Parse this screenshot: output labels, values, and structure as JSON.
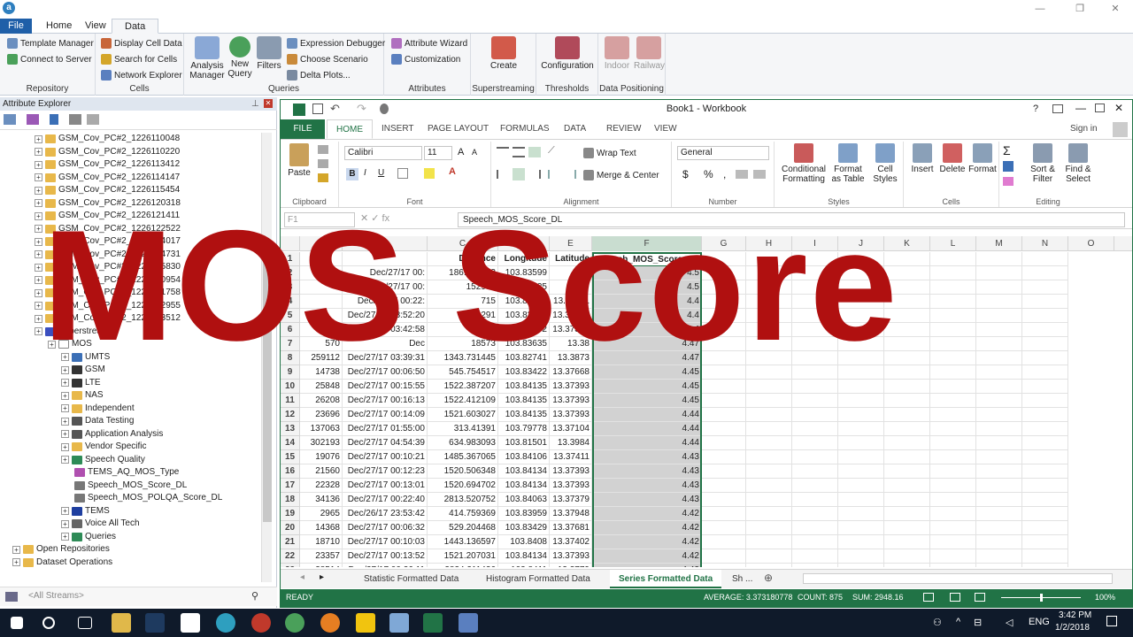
{
  "app": {
    "logo": "a",
    "tabs": [
      "File",
      "Home",
      "View",
      "Data"
    ],
    "ribbon_groups": [
      {
        "label": "Repository",
        "items": [
          "Template Manager",
          "Connect to Server"
        ]
      },
      {
        "label": "Cells",
        "items": [
          "Display Cell Data",
          "Search for Cells",
          "Network Explorer"
        ]
      },
      {
        "label": "Queries",
        "items": [
          "Analysis Manager",
          "New Query",
          "Filters",
          "Expression Debugger",
          "Choose Scenario",
          "Delta Plots..."
        ]
      },
      {
        "label": "Attributes",
        "items": [
          "Attribute Wizard",
          "Customization"
        ]
      },
      {
        "label": "Superstreaming",
        "items": [
          "Create"
        ]
      },
      {
        "label": "Thresholds",
        "items": [
          "Configuration"
        ]
      },
      {
        "label": "Data Positioning",
        "items": [
          "Indoor",
          "Railway"
        ]
      }
    ]
  },
  "explorer": {
    "title": "Attribute Explorer",
    "tree": [
      {
        "label": "GSM_Cov_PC#2_1226110048",
        "depth": 1,
        "kind": "folder"
      },
      {
        "label": "GSM_Cov_PC#2_1226110220",
        "depth": 1,
        "kind": "folder"
      },
      {
        "label": "GSM_Cov_PC#2_1226113412",
        "depth": 1,
        "kind": "folder"
      },
      {
        "label": "GSM_Cov_PC#2_1226114147",
        "depth": 1,
        "kind": "folder"
      },
      {
        "label": "GSM_Cov_PC#2_1226115454",
        "depth": 1,
        "kind": "folder"
      },
      {
        "label": "GSM_Cov_PC#2_1226120318",
        "depth": 1,
        "kind": "folder"
      },
      {
        "label": "GSM_Cov_PC#2_1226121411",
        "depth": 1,
        "kind": "folder"
      },
      {
        "label": "GSM_Cov_PC#2_1226122522",
        "depth": 1,
        "kind": "folder"
      },
      {
        "label": "GSM_Cov_PC#2_1226124017",
        "depth": 1,
        "kind": "folder"
      },
      {
        "label": "GSM_Cov_PC#2_1226124731",
        "depth": 1,
        "kind": "folder"
      },
      {
        "label": "GSM_Cov_PC#2_1226125830",
        "depth": 1,
        "kind": "folder"
      },
      {
        "label": "GSM_Cov_PC#2_1226130954",
        "depth": 1,
        "kind": "folder"
      },
      {
        "label": "GSM_Cov_PC#2_1226131758",
        "depth": 1,
        "kind": "folder"
      },
      {
        "label": "GSM_Cov_PC#2_1226132955",
        "depth": 1,
        "kind": "folder"
      },
      {
        "label": "GSM_Cov_PC#2_1226133512",
        "depth": 1,
        "kind": "folder"
      },
      {
        "label": "Superstreams",
        "depth": 1,
        "kind": "funnel"
      },
      {
        "label": "MOS",
        "depth": 2,
        "kind": "doc"
      },
      {
        "label": "UMTS",
        "depth": 3,
        "kind": "3g"
      },
      {
        "label": "GSM",
        "depth": 3,
        "kind": "gsm"
      },
      {
        "label": "LTE",
        "depth": 3,
        "kind": "lte"
      },
      {
        "label": "NAS",
        "depth": 3,
        "kind": "folder"
      },
      {
        "label": "Independent",
        "depth": 3,
        "kind": "folder"
      },
      {
        "label": "Data Testing",
        "depth": 3,
        "kind": "grid"
      },
      {
        "label": "Application Analysis",
        "depth": 3,
        "kind": "grid"
      },
      {
        "label": "Vendor Specific",
        "depth": 3,
        "kind": "folder"
      },
      {
        "label": "Speech Quality",
        "depth": 3,
        "kind": "q"
      },
      {
        "label": "TEMS_AQ_MOS_Type",
        "depth": 4,
        "kind": "item"
      },
      {
        "label": "Speech_MOS_Score_DL",
        "depth": 4,
        "kind": "mos"
      },
      {
        "label": "Speech_MOS_POLQA_Score_DL",
        "depth": 4,
        "kind": "mos"
      },
      {
        "label": "TEMS",
        "depth": 3,
        "kind": "tems"
      },
      {
        "label": "Voice All Tech",
        "depth": 3,
        "kind": "gear"
      },
      {
        "label": "Queries",
        "depth": 3,
        "kind": "q"
      },
      {
        "label": "Open Repositories",
        "depth": 0,
        "kind": "folder"
      },
      {
        "label": "Dataset Operations",
        "depth": 0,
        "kind": "folder"
      }
    ],
    "stream_placeholder": "<All Streams>"
  },
  "excel": {
    "title": "Book1 - Workbook",
    "sign_in": "Sign in",
    "tabs": [
      "FILE",
      "HOME",
      "INSERT",
      "PAGE LAYOUT",
      "FORMULAS",
      "DATA",
      "REVIEW",
      "VIEW"
    ],
    "font": "Calibri",
    "font_size": "11",
    "number_format": "General",
    "groups": [
      "Clipboard",
      "Font",
      "Alignment",
      "Number",
      "Styles",
      "Cells",
      "Editing"
    ],
    "buttons": {
      "paste": "Paste",
      "wrap": "Wrap Text",
      "merge": "Merge & Center",
      "cond": "Conditional Formatting",
      "fmt_table": "Format as Table",
      "cell_styles": "Cell Styles",
      "insert": "Insert",
      "delete": "Delete",
      "format": "Format",
      "sort": "Sort & Filter",
      "find": "Find & Select"
    },
    "name_box": "F1",
    "formula": "Speech_MOS_Score_DL",
    "columns": [
      "A",
      "B",
      "C",
      "D",
      "E",
      "F",
      "G",
      "H",
      "I",
      "J",
      "K",
      "L",
      "M",
      "N",
      "O"
    ],
    "headers": [
      "",
      "",
      "Distance",
      "Longitude",
      "Latitude",
      "Speech_MOS_Score_DL"
    ],
    "rows": [
      [
        "",
        "Dec/27/17 00:",
        "186.032623",
        "103.83599",
        "13.3",
        "4.5"
      ],
      [
        "",
        "Dec/27/17 00:",
        "152998",
        "103.84135",
        "13.37",
        "4.5"
      ],
      [
        "",
        "Dec/27/17 00:22:",
        "715",
        "103.84023",
        "13.37311",
        "4.4"
      ],
      [
        "",
        "Dec/27/17 03:52:20",
        "291",
        "103.83229",
        "13.38993",
        "4.4"
      ],
      [
        "",
        "Dec/27/17 03:42:58",
        "403",
        "103.83592",
        "13.37301",
        "4.4"
      ],
      [
        "570",
        "Dec",
        "18573",
        "103.83635",
        "13.38",
        "4.47"
      ],
      [
        "259112",
        "Dec/27/17 03:39:31",
        "1343.731445",
        "103.82741",
        "13.3873",
        "4.47"
      ],
      [
        "14738",
        "Dec/27/17 00:06:50",
        "545.754517",
        "103.83422",
        "13.37668",
        "4.45"
      ],
      [
        "25848",
        "Dec/27/17 00:15:55",
        "1522.387207",
        "103.84135",
        "13.37393",
        "4.45"
      ],
      [
        "26208",
        "Dec/27/17 00:16:13",
        "1522.412109",
        "103.84135",
        "13.37393",
        "4.45"
      ],
      [
        "23696",
        "Dec/27/17 00:14:09",
        "1521.603027",
        "103.84135",
        "13.37393",
        "4.44"
      ],
      [
        "137063",
        "Dec/27/17 01:55:00",
        "313.41391",
        "103.79778",
        "13.37104",
        "4.44"
      ],
      [
        "302193",
        "Dec/27/17 04:54:39",
        "634.983093",
        "103.81501",
        "13.3984",
        "4.44"
      ],
      [
        "19076",
        "Dec/27/17 00:10:21",
        "1485.367065",
        "103.84106",
        "13.37411",
        "4.43"
      ],
      [
        "21560",
        "Dec/27/17 00:12:23",
        "1520.506348",
        "103.84134",
        "13.37393",
        "4.43"
      ],
      [
        "22328",
        "Dec/27/17 00:13:01",
        "1520.694702",
        "103.84134",
        "13.37393",
        "4.43"
      ],
      [
        "34136",
        "Dec/27/17 00:22:40",
        "2813.520752",
        "103.84063",
        "13.37379",
        "4.43"
      ],
      [
        "2965",
        "Dec/26/17 23:53:42",
        "414.759369",
        "103.83959",
        "13.37948",
        "4.42"
      ],
      [
        "14368",
        "Dec/27/17 00:06:32",
        "529.204468",
        "103.83429",
        "13.37681",
        "4.42"
      ],
      [
        "18710",
        "Dec/27/17 00:10:03",
        "1443.136597",
        "103.8408",
        "13.37402",
        "4.42"
      ],
      [
        "23357",
        "Dec/27/17 00:13:52",
        "1521.207031",
        "103.84134",
        "13.37393",
        "4.42"
      ],
      [
        "38514",
        "Dec/27/17 00:26:11",
        "3834.211426",
        "103.8411",
        "13.3779",
        "4.42"
      ]
    ],
    "sheets": [
      "Statistic Formatted Data",
      "Histogram Formatted Data",
      "Series Formatted Data",
      "Sh ..."
    ],
    "status": {
      "ready": "READY",
      "average": "AVERAGE: 3.373180778",
      "count": "COUNT: 875",
      "sum": "SUM: 2948.16",
      "zoom": "100%"
    }
  },
  "taskbar": {
    "lang": "ENG",
    "time": "3:42 PM",
    "date": "1/2/2018"
  },
  "overlay": {
    "text": "MOS Score"
  }
}
